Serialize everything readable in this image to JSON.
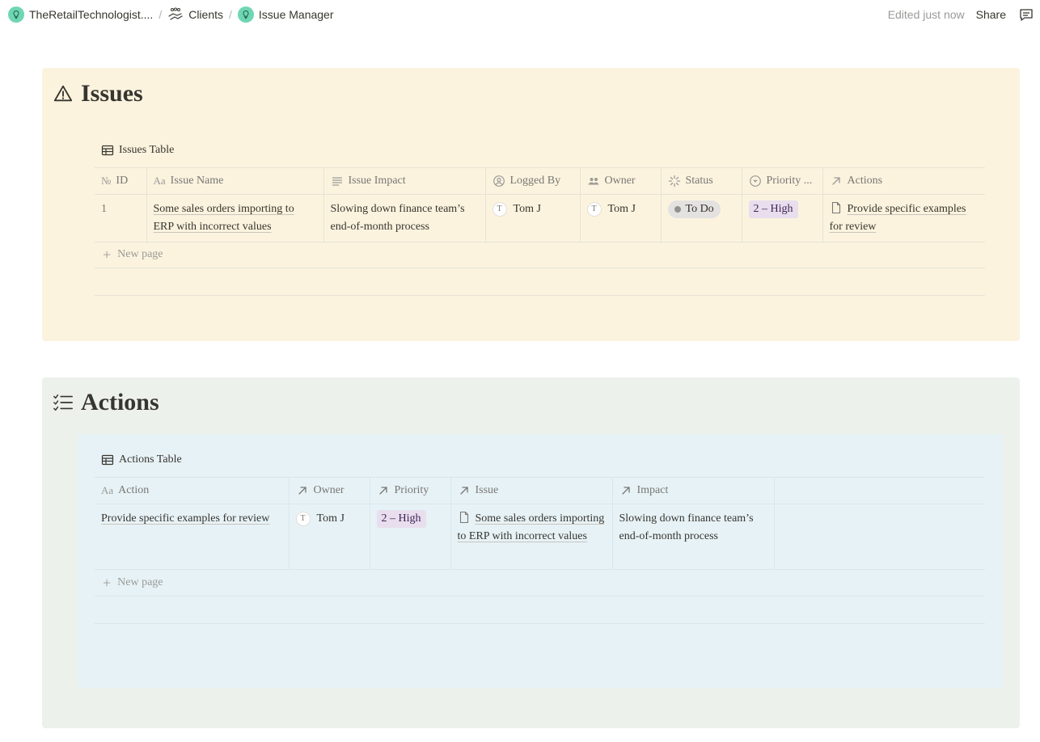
{
  "breadcrumb": {
    "workspace": "TheRetailTechnologist....",
    "clients": "Clients",
    "page": "Issue Manager",
    "separator": "/"
  },
  "topbar": {
    "edited": "Edited just now",
    "share": "Share"
  },
  "issues": {
    "title": "Issues",
    "db_title": "Issues Table",
    "columns": [
      "ID",
      "Issue Name",
      "Issue Impact",
      "Logged By",
      "Owner",
      "Status",
      "Priority ...",
      "Actions"
    ],
    "rows": [
      {
        "id": "1",
        "name": "Some sales orders importing to ERP with incorrect values",
        "impact": "Slowing down finance team’s end-of-month process",
        "logged_by": "Tom J",
        "logged_by_initial": "T",
        "owner": "Tom J",
        "owner_initial": "T",
        "status": "To Do",
        "priority": "2 – High",
        "actions": "Provide specific examples for review"
      }
    ],
    "new_page": "New page"
  },
  "actions": {
    "title": "Actions",
    "db_title": "Actions Table",
    "columns": [
      "Action",
      "Owner",
      "Priority",
      "Issue",
      "Impact"
    ],
    "rows": [
      {
        "action": "Provide specific examples for review",
        "owner": "Tom J",
        "owner_initial": "T",
        "priority": "2 – High",
        "issue": "Some sales orders importing to ERP with incorrect values",
        "impact": "Slowing down finance team’s end-of-month process"
      }
    ],
    "new_page": "New page"
  },
  "colors": {
    "issues_bg": "#fbf3de",
    "actions_bg": "#edf1ec",
    "actions_inner_bg": "#e7f2f6",
    "status_pill": "#e3e2e0",
    "priority_tag": "#e8deee",
    "workspace_icon": "#6fd6b4"
  }
}
